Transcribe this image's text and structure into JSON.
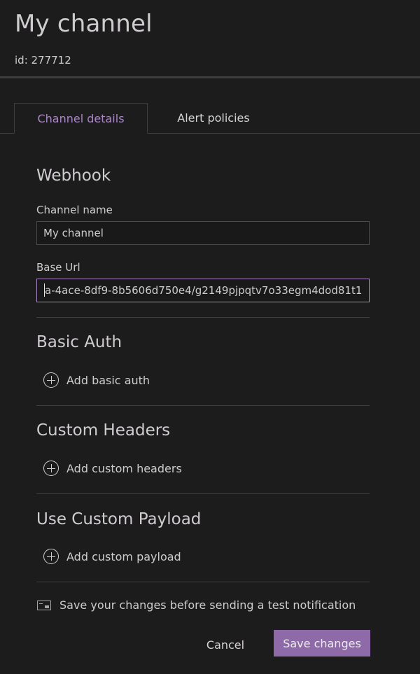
{
  "header": {
    "title": "My channel",
    "id_text": "id: 277712"
  },
  "tabs": [
    {
      "label": "Channel details",
      "active": true
    },
    {
      "label": "Alert policies",
      "active": false
    }
  ],
  "webhook": {
    "section_title": "Webhook",
    "channel_name_label": "Channel name",
    "channel_name_value": "My channel",
    "base_url_label": "Base Url",
    "base_url_value": "a-4ace-8df9-8b5606d750e4/g2149pjpqtv7o33egm4dod81t1"
  },
  "basic_auth": {
    "section_title": "Basic Auth",
    "add_label": "Add basic auth"
  },
  "custom_headers": {
    "section_title": "Custom Headers",
    "add_label": "Add custom headers"
  },
  "custom_payload": {
    "section_title": "Use Custom Payload",
    "add_label": "Add custom payload"
  },
  "footer": {
    "info_text": "Save your changes before sending a test notification",
    "cancel_label": "Cancel",
    "save_label": "Save changes"
  },
  "colors": {
    "background": "#1d1c1d",
    "accent": "#a987c4",
    "primary_button": "#8e6aa8",
    "border": "#3e3d3f"
  },
  "icons": {
    "add": "plus-circle-icon",
    "info": "notification-card-icon"
  }
}
